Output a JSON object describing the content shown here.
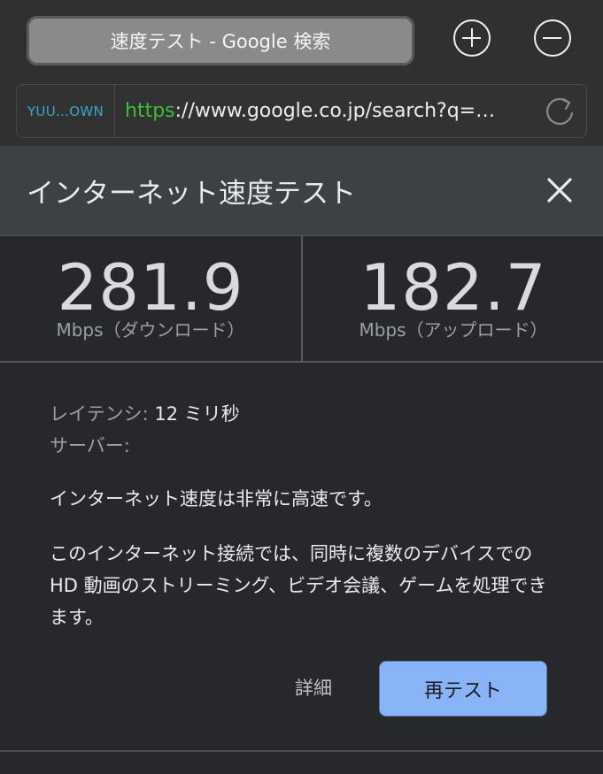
{
  "tab": {
    "title": "速度テスト - Google 検索"
  },
  "toolbar": {
    "new_tab_icon": "plus-icon",
    "close_tab_icon": "minus-icon"
  },
  "url_bar": {
    "user_label": "YUU…OWN",
    "scheme": "https",
    "rest": "://www.google.co.jp/search?q=…",
    "reload_icon": "reload-icon"
  },
  "speed_test": {
    "title": "インターネット速度テスト",
    "download": {
      "value": "281.9",
      "label": "Mbps（ダウンロード）"
    },
    "upload": {
      "value": "182.7",
      "label": "Mbps（アップロード）"
    },
    "latency_label": "レイテンシ:",
    "latency_value": "12 ミリ秒",
    "server_label": "サーバー:",
    "message_1": "インターネット速度は非常に高速です。",
    "message_2": "このインターネット接続では、同時に複数のデバイスでの HD 動画のストリーミング、ビデオ会議、ゲームを処理できます。",
    "details_label": "詳細",
    "retest_label": "再テスト"
  },
  "colors": {
    "background": "#2f3030",
    "card_header": "#3b4145",
    "panel": "#27282c",
    "accent_button": "#8ab4f8",
    "https_green": "#3dbb3d",
    "user_label_blue": "#3ba7c9"
  }
}
